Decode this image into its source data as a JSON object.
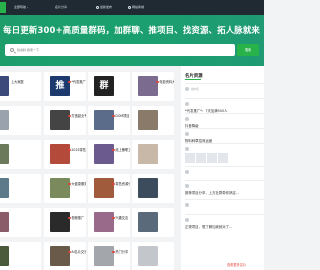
{
  "nav": {
    "items": [
      {
        "label": "全部导航",
        "chevron": "▾"
      },
      {
        "label": "名片分享",
        "chevron": ""
      },
      {
        "label": "最新发布",
        "chevron": ""
      },
      {
        "label": "网站商城",
        "chevron": ""
      }
    ]
  },
  "banner": {
    "slogan": "每日更新300+高质量群码，加群聊、推项目、找资源、拓人脉就来"
  },
  "search": {
    "placeholder": "找资料 搜索一下",
    "button_label": "搜索"
  },
  "cards": [
    {
      "title": "上大家庭",
      "thumb_text": "",
      "thumb_color": "#3b4a7a",
      "dot_color": ""
    },
    {
      "title": "*代发推广*",
      "thumb_text": "推",
      "thumb_color": "#1d3a6e",
      "dot_color": "#e0433a"
    },
    {
      "title": "",
      "thumb_text": "群",
      "thumb_color": "#222222",
      "dot_color": ""
    },
    {
      "title": "电影资料大全",
      "thumb_text": "",
      "thumb_color": "#7b6b8e",
      "dot_color": "#e0433a"
    },
    {
      "title": "",
      "thumb_text": "",
      "thumb_color": "#9aa3ad",
      "dot_color": ""
    },
    {
      "title": "打造副业专...",
      "thumb_text": "",
      "thumb_color": "#444444",
      "dot_color": "#e0433a"
    },
    {
      "title": "DOM项目",
      "thumb_text": "",
      "thumb_color": "#5a6c8a",
      "dot_color": "#e0433a"
    },
    {
      "title": "",
      "thumb_text": "",
      "thumb_color": "#8a7a6a",
      "dot_color": ""
    },
    {
      "title": "",
      "thumb_text": "",
      "thumb_color": "#6a7a5a",
      "dot_color": ""
    },
    {
      "title": "2025零售高...",
      "thumb_text": "",
      "thumb_color": "#b34a3a",
      "dot_color": "#e0433a"
    },
    {
      "title": "线上兼职工作",
      "thumb_text": "",
      "thumb_color": "#6b5a8e",
      "dot_color": "#e0433a"
    },
    {
      "title": "",
      "thumb_text": "",
      "thumb_color": "#c7b8a8",
      "dot_color": ""
    },
    {
      "title": "",
      "thumb_text": "",
      "thumb_color": "#5c7a8a",
      "dot_color": ""
    },
    {
      "title": "大健康服务",
      "thumb_text": "",
      "thumb_color": "#7a8a5c",
      "dot_color": "#e0433a"
    },
    {
      "title": "零售资源分...",
      "thumb_text": "",
      "thumb_color": "#a05a3c",
      "dot_color": "#e0433a"
    },
    {
      "title": "",
      "thumb_text": "",
      "thumb_color": "#3c4c5c",
      "dot_color": ""
    },
    {
      "title": "",
      "thumb_text": "",
      "thumb_color": "#8a5c6a",
      "dot_color": ""
    },
    {
      "title": "视频推广",
      "thumb_text": "",
      "thumb_color": "#2a2a2a",
      "dot_color": "#e0433a"
    },
    {
      "title": "兴趣交友",
      "thumb_text": "",
      "thumb_color": "#9a6a8a",
      "dot_color": "#e0433a"
    },
    {
      "title": "",
      "thumb_text": "",
      "thumb_color": "#5a6a7a",
      "dot_color": ""
    },
    {
      "title": "",
      "thumb_text": "",
      "thumb_color": "#4a5a3a",
      "dot_color": ""
    },
    {
      "title": "AI名片交流群",
      "thumb_text": "",
      "thumb_color": "#6a5a4a",
      "dot_color": "#e0433a"
    },
    {
      "title": "热门分享",
      "thumb_text": "",
      "thumb_color": "#a3a6aa",
      "dot_color": "#e0433a"
    },
    {
      "title": "",
      "thumb_text": "",
      "thumb_color": "#c3c6ca",
      "dot_color": ""
    }
  ],
  "panel": {
    "title": "名片资源",
    "items": [
      {
        "user": "用户名",
        "text": "",
        "has_thumbs": false
      },
      {
        "user": "",
        "text": "*代发推广*：7天加满500人",
        "has_thumbs": false
      },
      {
        "user": "",
        "text": "抖音降级",
        "has_thumbs": false
      },
      {
        "user": "",
        "text": "物料种草招商运营",
        "has_thumbs": false
      },
      {
        "user": "",
        "text": "",
        "has_thumbs": true
      },
      {
        "user": "",
        "text": "",
        "has_thumbs": false
      },
      {
        "user": "",
        "text": "推荐项目分享，上万社群带你搞定...",
        "has_thumbs": false
      },
      {
        "user": "",
        "text": "",
        "has_thumbs": false
      },
      {
        "user": "",
        "text": "正规项目，想了解加我就对了...",
        "has_thumbs": false
      }
    ],
    "view_more": "查看更多名片"
  },
  "colors": {
    "accent": "#27b24a",
    "banner": "#1e9d6b",
    "nav_bg": "#1f2a32",
    "link_red": "#e0433a"
  }
}
